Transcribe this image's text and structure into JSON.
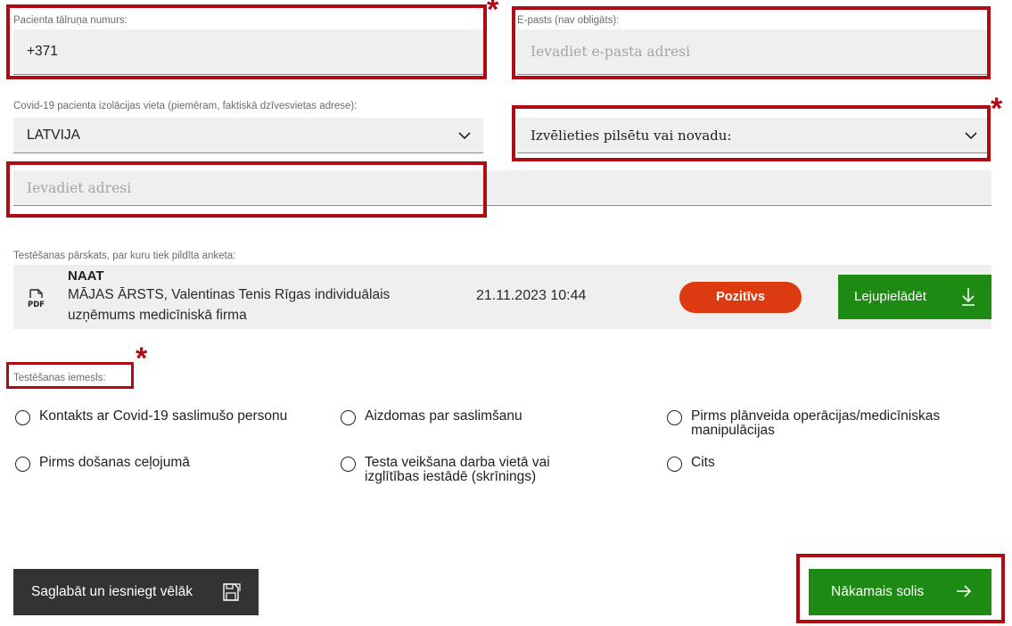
{
  "phone": {
    "label": "Pacienta tālruņa numurs:",
    "value": "+371"
  },
  "email": {
    "label": "E-pasts (nav obligāts):",
    "placeholder": "Ievadiet e-pasta adresi"
  },
  "isolation": {
    "label": "Covid-19 pacienta izolācijas vieta (piemēram, faktiskā dzīvesvietas adrese):",
    "country_value": "LATVIJA",
    "city_value": "Izvēlieties pilsētu vai novadu:",
    "address_placeholder": "Ievadiet adresi"
  },
  "report": {
    "label": "Testēšanas pārskats, par kuru tiek pildīta anketa:",
    "icon": "pdf-icon",
    "title": "NAAT",
    "description": "MĀJAS ĀRSTS, Valentinas Tenis Rīgas individuālais uzņēmums medicīniskā firma",
    "datetime": "21.11.2023 10:44",
    "result": "Pozitīvs",
    "download_label": "Lejupielādēt"
  },
  "reason": {
    "label": "Testēšanas iemesls:",
    "options": [
      "Kontakts ar Covid-19 saslimušo personu",
      "Aizdomas par saslimšanu",
      "Pirms plānveida operācijas/medicīniskas manipulācijas",
      "Pirms došanas ceļojumā",
      "Testa veikšana darba vietā vai izglītības iestādē (skrīnings)",
      "Cits"
    ]
  },
  "actions": {
    "save_later": "Saglabāt un iesniegt vēlāk",
    "next_step": "Nākamais solis"
  },
  "annotations": {
    "required_mark": "*"
  },
  "colors": {
    "highlight": "#b00a12",
    "positive_badge": "#dc3b12",
    "primary_green": "#1d8a14",
    "dark_button": "#333333",
    "field_bg": "#efefef"
  }
}
